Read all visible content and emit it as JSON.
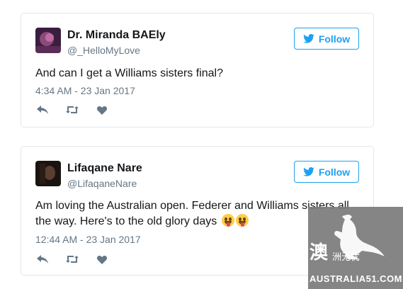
{
  "tweets": [
    {
      "name": "Dr. Miranda BAEly",
      "handle": "@_HelloMyLove",
      "text": "And can I get a Williams sisters final?",
      "time": "4:34 AM - 23 Jan 2017",
      "follow_label": "Follow",
      "avatar_colors": [
        "#3a1e3e",
        "#c06aa8"
      ]
    },
    {
      "name": "Lifaqane Nare",
      "handle": "@LifaqaneNare",
      "text": "Am loving the Australian open. Federer and Williams sisters all the way. Here's to the old glory days",
      "emoji": [
        "winking-face-with-tongue",
        "winking-face-with-tongue"
      ],
      "time": "12:44 AM - 23 Jan 2017",
      "follow_label": "Follow",
      "avatar_colors": [
        "#1a1410",
        "#5a3e30"
      ]
    }
  ],
  "colors": {
    "accent": "#1da1f2",
    "muted": "#657786",
    "action_icon": "#657786",
    "border": "#e1e8ed"
  },
  "watermark": {
    "big_char": "澳",
    "cn_text": "洲无忧",
    "en_text": "AUSTRALIA51.COM"
  }
}
